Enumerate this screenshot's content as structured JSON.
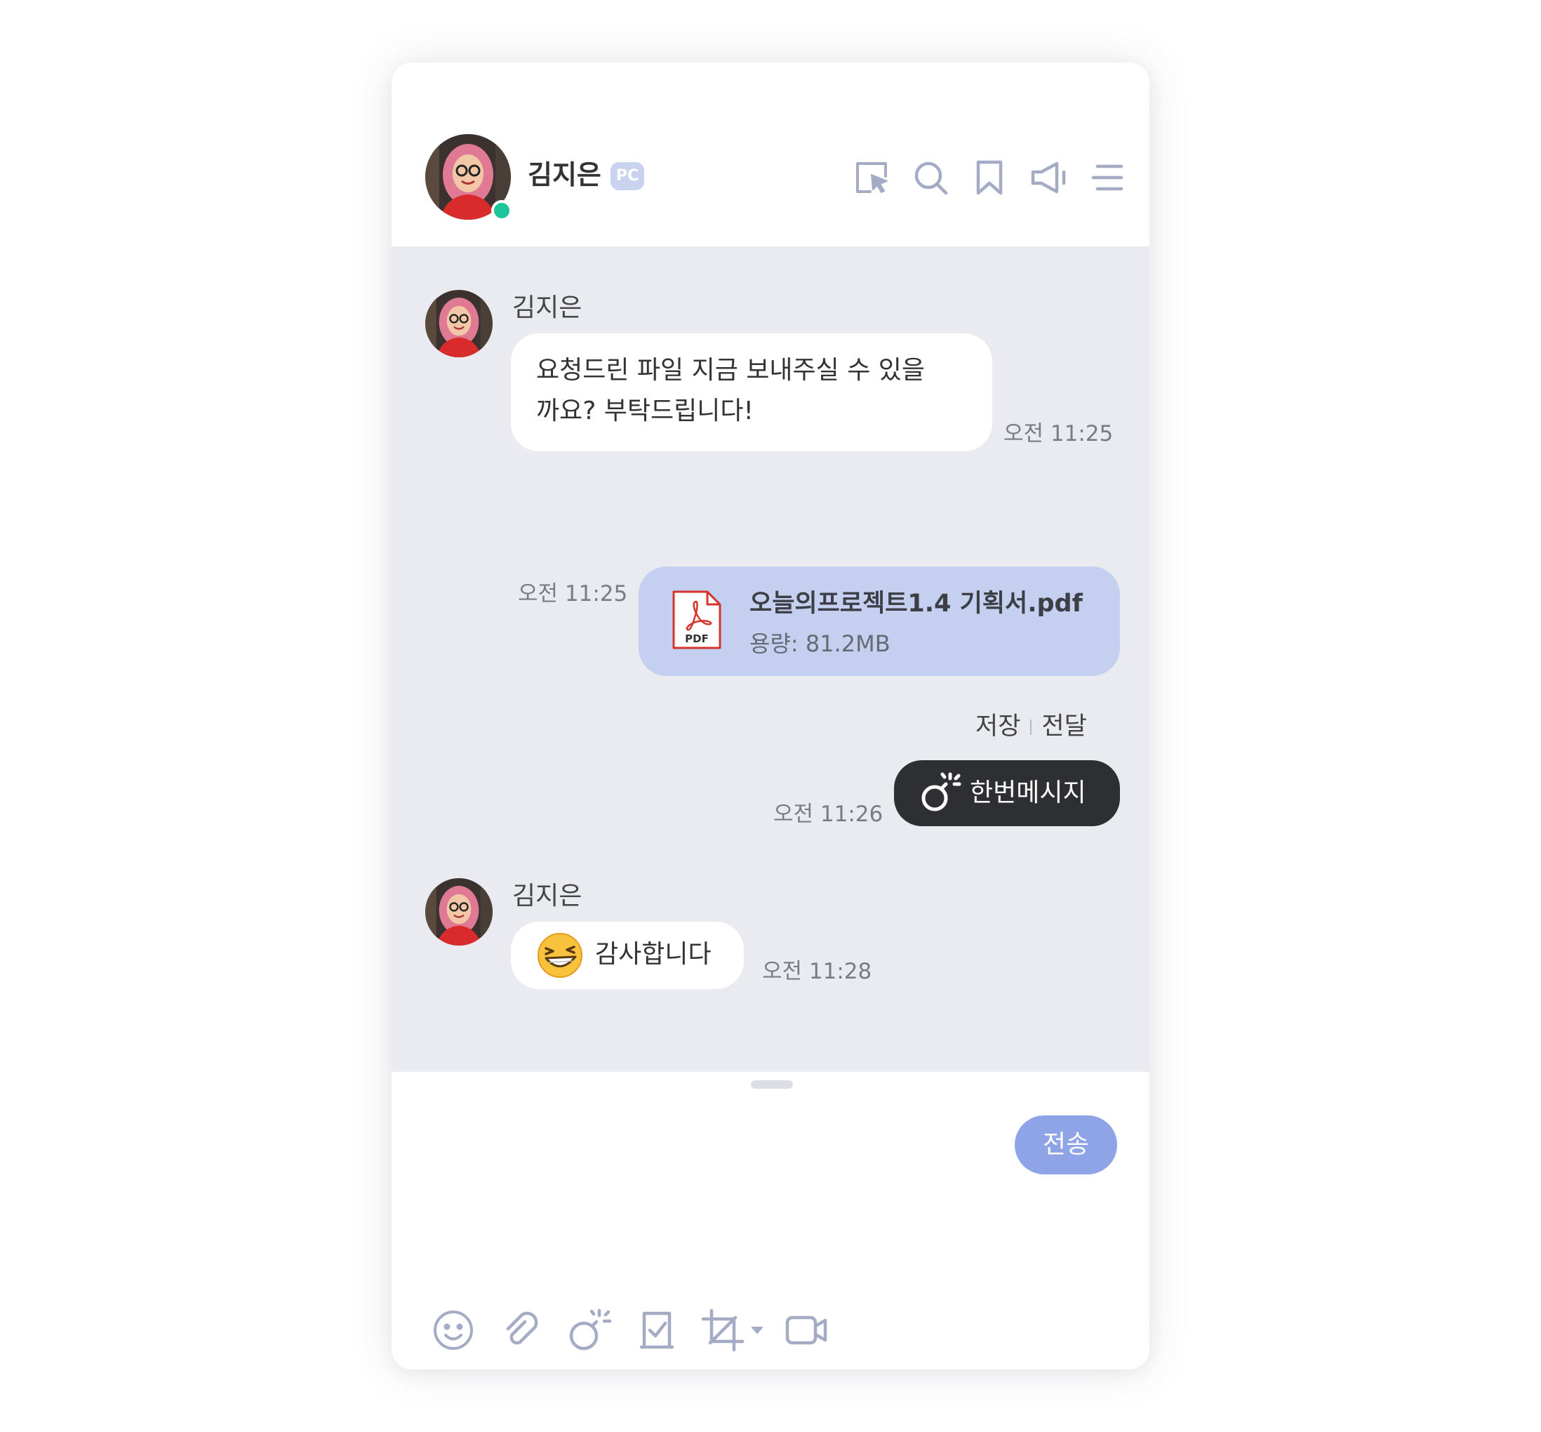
{
  "header": {
    "contact_name": "김지은",
    "device_badge": "PC",
    "online_color": "#1fc59a",
    "icons": [
      "screen-capture-icon",
      "search-icon",
      "bookmark-icon",
      "announcement-icon",
      "menu-icon"
    ]
  },
  "messages": {
    "m1": {
      "sender": "김지은",
      "line1": "요청드린 파일 지금 보내주실 수 있을",
      "line2": "까요? 부탁드립니다!",
      "time": "오전 11:25"
    },
    "m2": {
      "file_name": "오늘의프로젝트1.4 기획서.pdf",
      "file_size": "용량: 81.2MB",
      "file_icon_label": "PDF",
      "time": "오전 11:25",
      "save_label": "저장",
      "forward_label": "전달"
    },
    "m3": {
      "text": "한번메시지",
      "time": "오전 11:26"
    },
    "m4": {
      "sender": "김지은",
      "text": "감사합니다",
      "time": "오전 11:28"
    }
  },
  "composer": {
    "send_label": "전송",
    "toolbar_icons": [
      "emoji-icon",
      "attach-icon",
      "one-time-message-icon",
      "todo-icon",
      "capture-icon",
      "video-call-icon"
    ]
  },
  "colors": {
    "chat_background": "#eaebf0",
    "own_file_bubble": "#c5cff0",
    "once_bubble": "#2d2f33",
    "send_button": "#8ea4e6",
    "icon_color": "#a3acc4"
  }
}
